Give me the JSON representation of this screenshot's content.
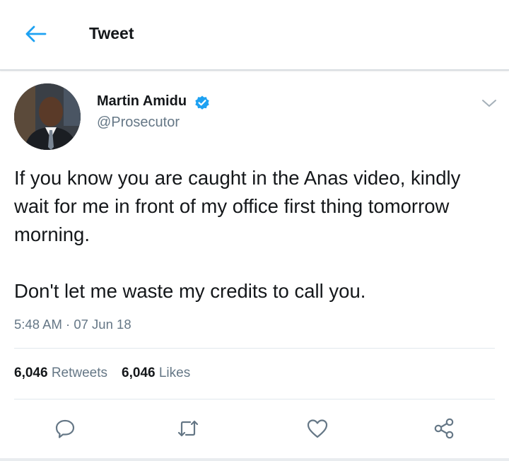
{
  "header": {
    "title": "Tweet",
    "back_icon": "back-arrow-icon",
    "accent": "#1da1f2"
  },
  "tweet": {
    "author_name": "Martin Amidu",
    "handle": "@Prosecutor",
    "verified": true,
    "text": [
      "If you know you are caught in the Anas video, kindly wait for me in front of my office first thing tomorrow morning.",
      "Don't let me waste my credits to call you."
    ],
    "time": "5:48 AM",
    "separator": "·",
    "date": "07 Jun 18",
    "stats": {
      "retweets_count": "6,046",
      "retweets_label": "Retweets",
      "likes_count": "6,046",
      "likes_label": "Likes"
    },
    "actions": [
      "reply-icon",
      "retweet-icon",
      "like-icon",
      "share-icon"
    ]
  },
  "colors": {
    "text_primary": "#14171a",
    "text_secondary": "#657786",
    "divider": "#e1e8ed",
    "verified_badge": "#1da1f2",
    "icon_gray": "#657786"
  }
}
